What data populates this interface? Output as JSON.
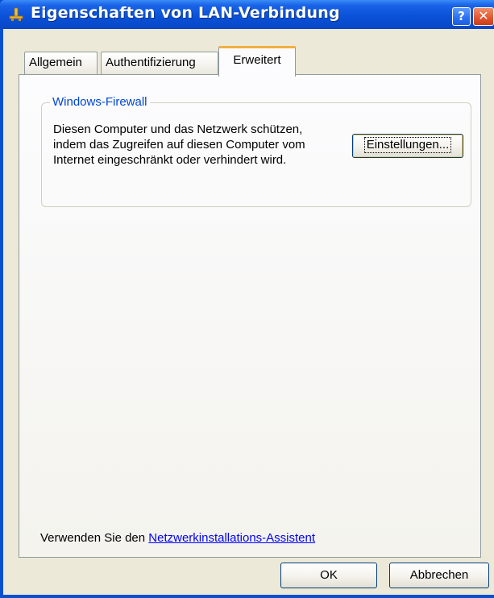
{
  "window": {
    "title": "Eigenschaften von LAN-Verbindung",
    "help_label": "?",
    "close_label": "✕"
  },
  "tabs": [
    {
      "label": "Allgemein",
      "selected": false
    },
    {
      "label": "Authentifizierung",
      "selected": false
    },
    {
      "label": "Erweitert",
      "selected": true
    }
  ],
  "firewall": {
    "group_label": "Windows-Firewall",
    "description": "Diesen Computer und das Netzwerk schützen, indem das Zugreifen auf diesen Computer vom Internet eingeschränkt oder verhindert wird.",
    "settings_button": "Einstellungen..."
  },
  "footer": {
    "prefix": "Verwenden Sie den ",
    "link": "Netzwerkinstallations-Assistent"
  },
  "buttons": {
    "ok": "OK",
    "cancel": "Abbrechen"
  },
  "colors": {
    "titlebar": "#0a52d8",
    "accent_link": "#0000ff",
    "group_label": "#0046d5",
    "dialog_bg": "#ece9d8"
  },
  "icons": {
    "title": "network-connection-icon"
  }
}
